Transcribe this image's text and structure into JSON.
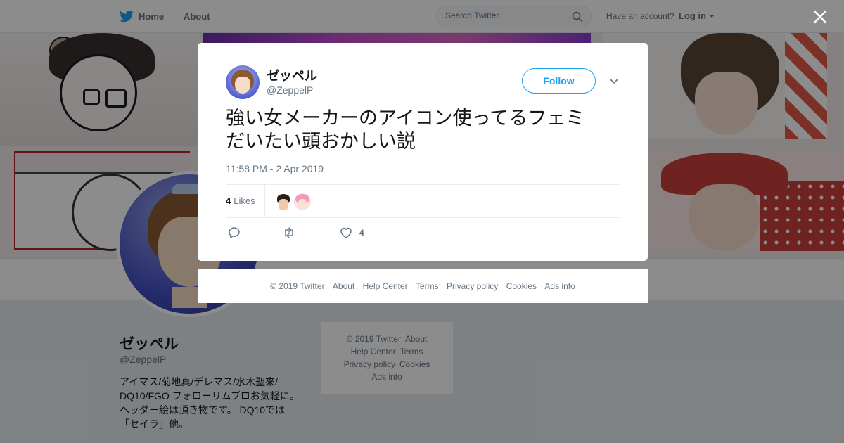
{
  "topbar": {
    "brand_icon": "twitter-bird-icon",
    "home": "Home",
    "about": "About",
    "search_placeholder": "Search Twitter",
    "have_account": "Have an account?",
    "login": "Log in"
  },
  "profile": {
    "name": "ゼッペル",
    "handle": "@ZeppelP",
    "bio_lines": [
      "アイマス/菊地真/デレマス/水木聖來/",
      "DQ10/FGO フォローリムブロお気軽に。",
      "ヘッダー絵は頂き物です。 DQ10では",
      "「セイラ」他。"
    ]
  },
  "side_footer": {
    "copyright": "© 2019 Twitter",
    "about": "About",
    "help": "Help Center",
    "terms": "Terms",
    "privacy": "Privacy policy",
    "cookies": "Cookies",
    "ads": "Ads info"
  },
  "tweet": {
    "author_name": "ゼッペル",
    "author_handle": "@ZeppelP",
    "follow_label": "Follow",
    "text_lines": [
      "強い女メーカーのアイコン使ってるフェミ",
      "だいたい頭おかしい説"
    ],
    "timestamp": "11:58 PM - 2 Apr 2019",
    "likes_count": "4",
    "likes_label": "Likes",
    "like_action_count": "4"
  },
  "modal_footer": {
    "copyright": "© 2019 Twitter",
    "about": "About",
    "help": "Help Center",
    "terms": "Terms",
    "privacy": "Privacy policy",
    "cookies": "Cookies",
    "ads": "Ads info"
  },
  "colors": {
    "twitter_blue": "#1da1f2",
    "text_primary": "#14171a",
    "text_secondary": "#657786",
    "background": "#e6ecf0"
  }
}
